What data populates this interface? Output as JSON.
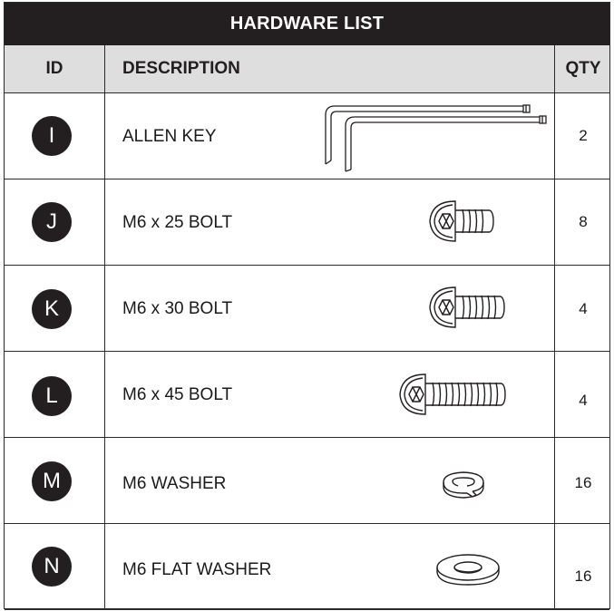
{
  "title": "HARDWARE LIST",
  "headers": {
    "id": "ID",
    "description": "DESCRIPTION",
    "qty": "QTY"
  },
  "rows": [
    {
      "id": "I",
      "description": "ALLEN KEY",
      "qty": "2",
      "icon": "allen-key-icon"
    },
    {
      "id": "J",
      "description": "M6 x 25 BOLT",
      "qty": "8",
      "icon": "bolt-25-icon"
    },
    {
      "id": "K",
      "description": "M6 x 30 BOLT",
      "qty": "4",
      "icon": "bolt-30-icon"
    },
    {
      "id": "L",
      "description": "M6 x 45 BOLT",
      "qty": "4",
      "icon": "bolt-45-icon"
    },
    {
      "id": "M",
      "description": "M6 WASHER",
      "qty": "16",
      "icon": "lock-washer-icon"
    },
    {
      "id": "N",
      "description": "M6 FLAT WASHER",
      "qty": "16",
      "icon": "flat-washer-icon"
    }
  ],
  "colors": {
    "title_bg": "#231f20",
    "header_bg": "#dededf",
    "badge_bg": "#231f20",
    "line": "#2a2a2a"
  }
}
